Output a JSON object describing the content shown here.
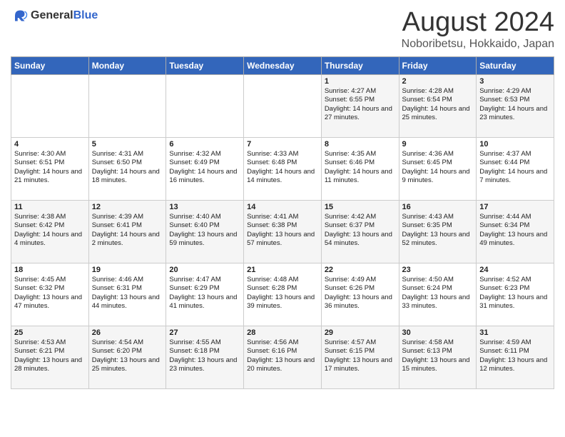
{
  "header": {
    "logo_general": "General",
    "logo_blue": "Blue",
    "title": "August 2024",
    "subtitle": "Noboribetsu, Hokkaido, Japan"
  },
  "days_of_week": [
    "Sunday",
    "Monday",
    "Tuesday",
    "Wednesday",
    "Thursday",
    "Friday",
    "Saturday"
  ],
  "weeks": [
    [
      {
        "day": "",
        "info": ""
      },
      {
        "day": "",
        "info": ""
      },
      {
        "day": "",
        "info": ""
      },
      {
        "day": "",
        "info": ""
      },
      {
        "day": "1",
        "info": "Sunrise: 4:27 AM\nSunset: 6:55 PM\nDaylight: 14 hours and 27 minutes."
      },
      {
        "day": "2",
        "info": "Sunrise: 4:28 AM\nSunset: 6:54 PM\nDaylight: 14 hours and 25 minutes."
      },
      {
        "day": "3",
        "info": "Sunrise: 4:29 AM\nSunset: 6:53 PM\nDaylight: 14 hours and 23 minutes."
      }
    ],
    [
      {
        "day": "4",
        "info": "Sunrise: 4:30 AM\nSunset: 6:51 PM\nDaylight: 14 hours and 21 minutes."
      },
      {
        "day": "5",
        "info": "Sunrise: 4:31 AM\nSunset: 6:50 PM\nDaylight: 14 hours and 18 minutes."
      },
      {
        "day": "6",
        "info": "Sunrise: 4:32 AM\nSunset: 6:49 PM\nDaylight: 14 hours and 16 minutes."
      },
      {
        "day": "7",
        "info": "Sunrise: 4:33 AM\nSunset: 6:48 PM\nDaylight: 14 hours and 14 minutes."
      },
      {
        "day": "8",
        "info": "Sunrise: 4:35 AM\nSunset: 6:46 PM\nDaylight: 14 hours and 11 minutes."
      },
      {
        "day": "9",
        "info": "Sunrise: 4:36 AM\nSunset: 6:45 PM\nDaylight: 14 hours and 9 minutes."
      },
      {
        "day": "10",
        "info": "Sunrise: 4:37 AM\nSunset: 6:44 PM\nDaylight: 14 hours and 7 minutes."
      }
    ],
    [
      {
        "day": "11",
        "info": "Sunrise: 4:38 AM\nSunset: 6:42 PM\nDaylight: 14 hours and 4 minutes."
      },
      {
        "day": "12",
        "info": "Sunrise: 4:39 AM\nSunset: 6:41 PM\nDaylight: 14 hours and 2 minutes."
      },
      {
        "day": "13",
        "info": "Sunrise: 4:40 AM\nSunset: 6:40 PM\nDaylight: 13 hours and 59 minutes."
      },
      {
        "day": "14",
        "info": "Sunrise: 4:41 AM\nSunset: 6:38 PM\nDaylight: 13 hours and 57 minutes."
      },
      {
        "day": "15",
        "info": "Sunrise: 4:42 AM\nSunset: 6:37 PM\nDaylight: 13 hours and 54 minutes."
      },
      {
        "day": "16",
        "info": "Sunrise: 4:43 AM\nSunset: 6:35 PM\nDaylight: 13 hours and 52 minutes."
      },
      {
        "day": "17",
        "info": "Sunrise: 4:44 AM\nSunset: 6:34 PM\nDaylight: 13 hours and 49 minutes."
      }
    ],
    [
      {
        "day": "18",
        "info": "Sunrise: 4:45 AM\nSunset: 6:32 PM\nDaylight: 13 hours and 47 minutes."
      },
      {
        "day": "19",
        "info": "Sunrise: 4:46 AM\nSunset: 6:31 PM\nDaylight: 13 hours and 44 minutes."
      },
      {
        "day": "20",
        "info": "Sunrise: 4:47 AM\nSunset: 6:29 PM\nDaylight: 13 hours and 41 minutes."
      },
      {
        "day": "21",
        "info": "Sunrise: 4:48 AM\nSunset: 6:28 PM\nDaylight: 13 hours and 39 minutes."
      },
      {
        "day": "22",
        "info": "Sunrise: 4:49 AM\nSunset: 6:26 PM\nDaylight: 13 hours and 36 minutes."
      },
      {
        "day": "23",
        "info": "Sunrise: 4:50 AM\nSunset: 6:24 PM\nDaylight: 13 hours and 33 minutes."
      },
      {
        "day": "24",
        "info": "Sunrise: 4:52 AM\nSunset: 6:23 PM\nDaylight: 13 hours and 31 minutes."
      }
    ],
    [
      {
        "day": "25",
        "info": "Sunrise: 4:53 AM\nSunset: 6:21 PM\nDaylight: 13 hours and 28 minutes."
      },
      {
        "day": "26",
        "info": "Sunrise: 4:54 AM\nSunset: 6:20 PM\nDaylight: 13 hours and 25 minutes."
      },
      {
        "day": "27",
        "info": "Sunrise: 4:55 AM\nSunset: 6:18 PM\nDaylight: 13 hours and 23 minutes."
      },
      {
        "day": "28",
        "info": "Sunrise: 4:56 AM\nSunset: 6:16 PM\nDaylight: 13 hours and 20 minutes."
      },
      {
        "day": "29",
        "info": "Sunrise: 4:57 AM\nSunset: 6:15 PM\nDaylight: 13 hours and 17 minutes."
      },
      {
        "day": "30",
        "info": "Sunrise: 4:58 AM\nSunset: 6:13 PM\nDaylight: 13 hours and 15 minutes."
      },
      {
        "day": "31",
        "info": "Sunrise: 4:59 AM\nSunset: 6:11 PM\nDaylight: 13 hours and 12 minutes."
      }
    ]
  ]
}
